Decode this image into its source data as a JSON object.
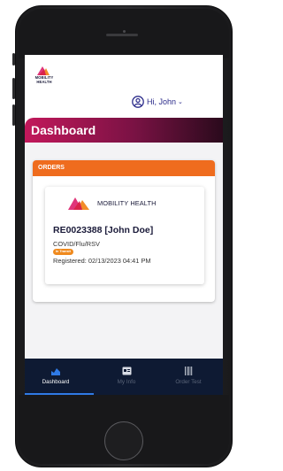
{
  "brand": {
    "logo_text_line1": "MOBILITY",
    "logo_text_line2": "HEALTH",
    "name": "MOBILITY HEALTH",
    "colors": {
      "pink": "#e0357a",
      "orange": "#f28c28",
      "red": "#d9234a",
      "navy": "#1b1b3a"
    }
  },
  "user": {
    "greeting": "Hi, John",
    "icon": "user-circle-icon"
  },
  "header": {
    "title": "Dashboard"
  },
  "orders": {
    "section_title": "ORDERS",
    "items": [
      {
        "id": "RE0023388 [John Doe]",
        "test": "COVID/Flu/RSV",
        "status": "In Transit",
        "registered": "Registered: 02/13/2023 04:41 PM"
      }
    ]
  },
  "nav": {
    "items": [
      {
        "label": "Dashboard",
        "icon": "chart-icon",
        "active": true
      },
      {
        "label": "My Info",
        "icon": "id-card-icon",
        "active": false
      },
      {
        "label": "Order Test",
        "icon": "barcode-icon",
        "active": false
      }
    ]
  },
  "theme": {
    "header_gradient_start": "#c2185b",
    "header_gradient_end": "#2a0a1c",
    "orders_accent": "#ef6c1e",
    "navbar_bg": "#0e1a33",
    "nav_active_underline": "#2f7ae5"
  }
}
